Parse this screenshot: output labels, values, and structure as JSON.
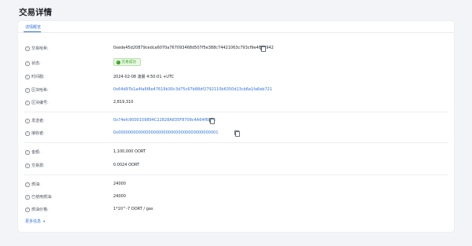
{
  "page": {
    "title": "交易详情"
  },
  "tabs": [
    {
      "label": "详情概览"
    }
  ],
  "details": {
    "tx_hash": {
      "label": "交易哈希:",
      "value": "0xede45d20879cedca6070a767093468d507f5e388c74421063c793cf9e4840942"
    },
    "status": {
      "label": "状态:",
      "value": "交易成功"
    },
    "timestamp": {
      "label": "时间戳:",
      "value": "2024-02-08 凌晨 4:50:01 +UTC"
    },
    "block_hash": {
      "label": "区块哈希:",
      "value": "0x64d97b1a4fa6f8e47619b30c3d75c67b88df2792110b6350d13cb6e1fa6eb721"
    },
    "block_number": {
      "label": "区块编号:",
      "value": "2,819,310"
    },
    "from": {
      "label": "发送者:",
      "value": "0x74efc9000159894C22828A835F8709c4A64f6b25"
    },
    "to": {
      "label": "接收者:",
      "value": "0x0000000000000000000000000000000000000001"
    },
    "amount": {
      "label": "金额:",
      "value": "1,100,000 OORT"
    },
    "fee": {
      "label": "交易费:",
      "value": "0.0024 OORT"
    },
    "gas_limit": {
      "label": "燃油:",
      "value": "24000"
    },
    "gas_used": {
      "label": "已使用燃油:",
      "value": "24000"
    },
    "gas_price": {
      "label": "燃油价格:",
      "value": "1*10^-7 OORT / gas"
    }
  },
  "more": {
    "label": "更多信息"
  },
  "colors": {
    "accent": "#3273dc",
    "success": "#36a41f",
    "background": "#f3f4f7"
  }
}
